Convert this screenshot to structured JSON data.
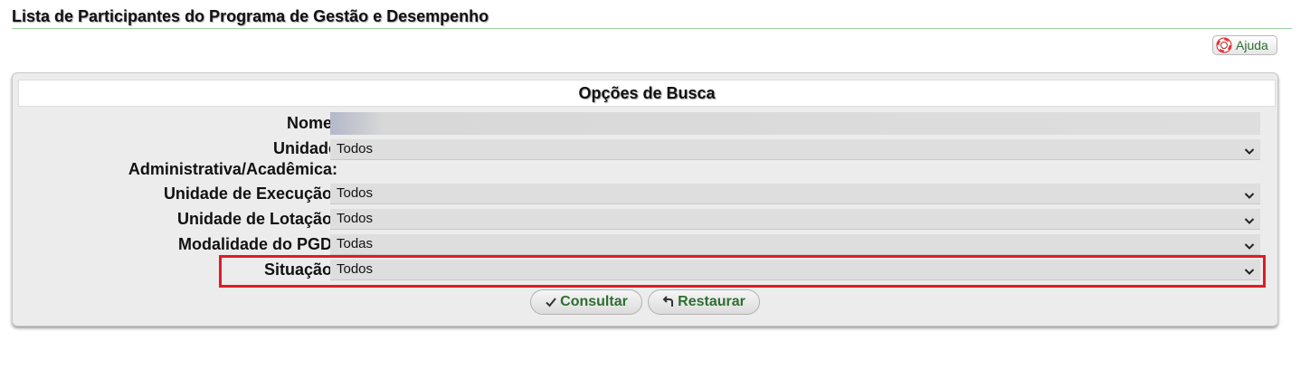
{
  "page": {
    "title": "Lista de Participantes do Programa de Gestão e Desempenho"
  },
  "help": {
    "label": "Ajuda",
    "icon": "lifebuoy-icon"
  },
  "search": {
    "header": "Opções de Busca",
    "fields": {
      "nome": {
        "label": "Nome:",
        "value": ""
      },
      "unidade_adm": {
        "label_line1": "Unidade",
        "label_line2": "Administrativa/Acadêmica:",
        "value": "Todos"
      },
      "unidade_exec": {
        "label": "Unidade de Execução:",
        "value": "Todos"
      },
      "unidade_lot": {
        "label": "Unidade de Lotação:",
        "value": "Todos"
      },
      "modalidade": {
        "label": "Modalidade do PGD:",
        "value": "Todas"
      },
      "situacao": {
        "label": "Situação:",
        "value": "Todos"
      }
    },
    "buttons": {
      "consultar": "Consultar",
      "restaurar": "Restaurar"
    }
  },
  "colors": {
    "accent_green": "#2e6e2e",
    "highlight_red": "#e01b24"
  }
}
